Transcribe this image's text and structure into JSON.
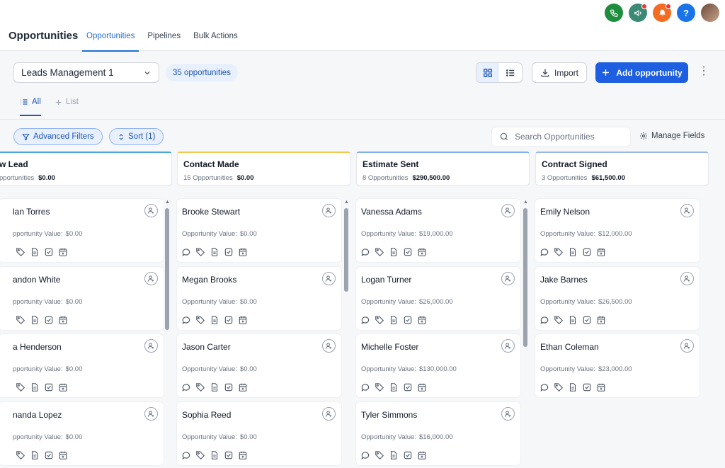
{
  "header": {
    "app_title": "Opportunities",
    "tabs": [
      {
        "label": "Opportunities",
        "active": true
      },
      {
        "label": "Pipelines",
        "active": false
      },
      {
        "label": "Bulk Actions",
        "active": false
      }
    ],
    "icons": [
      {
        "name": "phone-icon",
        "color": "#1e8e3e"
      },
      {
        "name": "megaphone-icon",
        "color": "#3a8a74"
      },
      {
        "name": "bell-icon",
        "color": "#f36c21"
      },
      {
        "name": "help-icon",
        "color": "#1a73e8"
      }
    ]
  },
  "toolbar": {
    "pipeline_value": "Leads Management 1",
    "count_label": "35 opportunities",
    "import_label": "Import",
    "add_label": "Add opportunity"
  },
  "view_tabs": {
    "all_label": "All",
    "list_label": "List"
  },
  "filters": {
    "advanced_label": "Advanced Filters",
    "sort_label": "Sort (1)",
    "search_placeholder": "Search Opportunities",
    "manage_fields_label": "Manage Fields"
  },
  "columns": [
    {
      "title": "w Lead",
      "count": "pportunities",
      "total": "$0.00",
      "accent": "#4aa8d8",
      "cards": [
        {
          "name": "lan Torres",
          "label": "pportunity Value:",
          "value": "$0.00"
        },
        {
          "name": "andon White",
          "label": "pportunity Value:",
          "value": "$0.00"
        },
        {
          "name": "a Henderson",
          "label": "pportunity Value:",
          "value": "$0.00"
        },
        {
          "name": "nanda Lopez",
          "label": "pportunity Value:",
          "value": "$0.00"
        }
      ]
    },
    {
      "title": "Contact Made",
      "count": "15 Opportunities",
      "total": "$0.00",
      "accent": "#f2c94c",
      "cards": [
        {
          "name": "Brooke Stewart",
          "label": "Opportunity Value:",
          "value": "$0.00"
        },
        {
          "name": "Megan Brooks",
          "label": "Opportunity Value:",
          "value": "$0.00"
        },
        {
          "name": "Jason Carter",
          "label": "Opportunity Value:",
          "value": "$0.00"
        },
        {
          "name": "Sophia Reed",
          "label": "Opportunity Value:",
          "value": "$0.00"
        }
      ]
    },
    {
      "title": "Estimate Sent",
      "count": "8 Opportunities",
      "total": "$290,500.00",
      "accent": "#7fb0e8",
      "cards": [
        {
          "name": "Vanessa Adams",
          "label": "Opportunity Value:",
          "value": "$19,000.00"
        },
        {
          "name": "Logan Turner",
          "label": "Opportunity Value:",
          "value": "$26,000.00"
        },
        {
          "name": "Michelle Foster",
          "label": "Opportunity Value:",
          "value": "$130,000.00"
        },
        {
          "name": "Tyler Simmons",
          "label": "Opportunity Value:",
          "value": "$16,000.00"
        }
      ]
    },
    {
      "title": "Contract Signed",
      "count": "3 Opportunities",
      "total": "$61,500.00",
      "accent": "#9bb7e6",
      "cards": [
        {
          "name": "Emily Nelson",
          "label": "Opportunity Value:",
          "value": "$12,000.00"
        },
        {
          "name": "Jake Barnes",
          "label": "Opportunity Value:",
          "value": "$26,500.00"
        },
        {
          "name": "Ethan Coleman",
          "label": "Opportunity Value:",
          "value": "$23,000.00"
        }
      ]
    }
  ]
}
